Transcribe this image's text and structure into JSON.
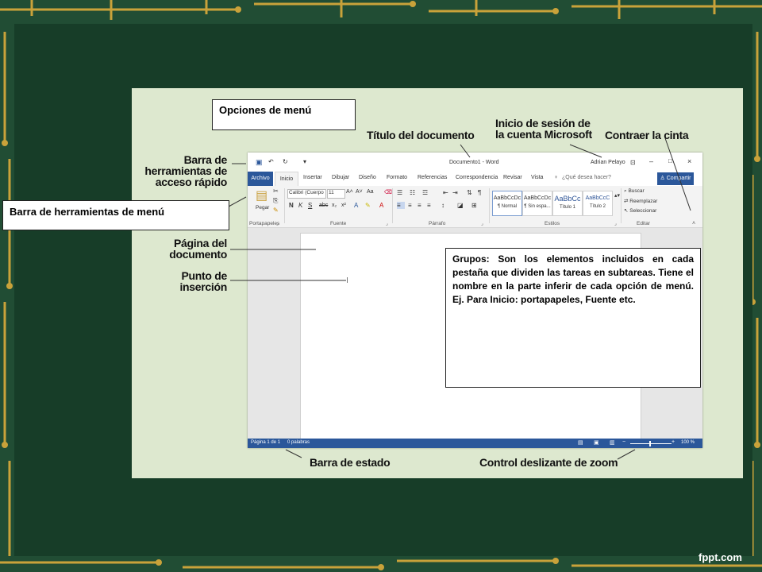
{
  "slide": {
    "brand": "fppt.com",
    "colors": {
      "background": "#214d34",
      "panel": "#173d28",
      "figure_bg": "#dde8cf",
      "word_blue": "#2b579a",
      "circuit": "#c9a23a"
    }
  },
  "callouts": {
    "titulo_documento": "Título del documento",
    "inicio_sesion": "Inicio de sesión de la cuenta Microsoft",
    "contraer_cinta": "Contraer la cinta",
    "barra_acceso_rapido": "Barra de herramientas de acceso rápido",
    "pagina_documento": "Página del documento",
    "punto_insercion": "Punto de inserción",
    "barra_estado": "Barra de estado",
    "control_zoom": "Control deslizante de zoom"
  },
  "notes": {
    "opciones_menu": "Opciones de menú",
    "barra_menu": "Barra de herramientas de menú",
    "grupos": "Grupos: Son los elementos incluidos en cada pestaña que dividen las tareas en subtareas. Tiene el nombre en la parte inferir de cada opción de menú. Ej. Para Inicio: portapapeles, Fuente etc."
  },
  "word": {
    "title": "Documento1 - Word",
    "user": "Adrian Pelayo",
    "tell_me": "¿Qué desea hacer?",
    "share": "Compartir",
    "tabs": [
      "Archivo",
      "Inicio",
      "Insertar",
      "Dibujar",
      "Diseño",
      "Formato",
      "Referencias",
      "Correspondencia",
      "Revisar",
      "Vista"
    ],
    "font_name": "Calibri (Cuerpo",
    "font_size": "11",
    "paste": "Pegar",
    "styles": [
      {
        "preview": "AaBbCcDc",
        "name": "¶ Normal"
      },
      {
        "preview": "AaBbCcDc",
        "name": "¶ Sin espa..."
      },
      {
        "preview": "AaBbCc",
        "name": "Título 1"
      },
      {
        "preview": "AaBbCcC",
        "name": "Título 2"
      }
    ],
    "edit": {
      "buscar": "Buscar",
      "reemplazar": "Reemplazar",
      "seleccionar": "Seleccionar"
    },
    "groups": [
      "Portapapeles",
      "Fuente",
      "Párrafo",
      "Estilos",
      "Editar"
    ],
    "status": {
      "page": "Página 1 de 1",
      "words": "0 palabras",
      "zoom": "100 %"
    }
  }
}
